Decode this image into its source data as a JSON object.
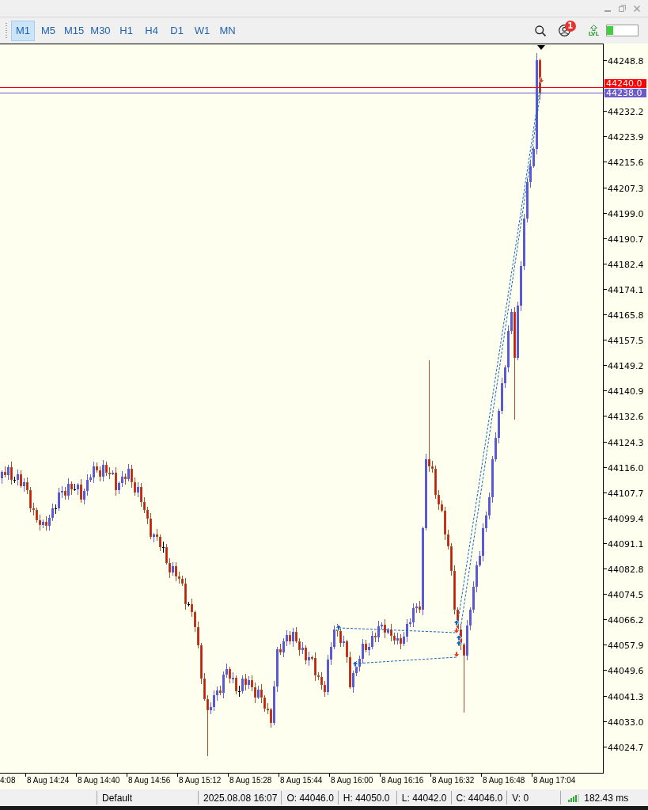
{
  "toolbar": {
    "timeframes": [
      {
        "label": "M1",
        "selected": true
      },
      {
        "label": "M5",
        "selected": false
      },
      {
        "label": "M15",
        "selected": false
      },
      {
        "label": "M30",
        "selected": false
      },
      {
        "label": "H1",
        "selected": false
      },
      {
        "label": "H4",
        "selected": false
      },
      {
        "label": "D1",
        "selected": false
      },
      {
        "label": "W1",
        "selected": false
      },
      {
        "label": "MN",
        "selected": false
      }
    ],
    "notification_badge": "1",
    "lvl_label": "LVL",
    "meter": {
      "level": 0.2
    }
  },
  "chart": {
    "price_ticks": [
      "44248.8",
      "44232.2",
      "44223.9",
      "44215.6",
      "44207.3",
      "44199.0",
      "44190.7",
      "44182.4",
      "44174.1",
      "44165.8",
      "44157.5",
      "44149.2",
      "44140.9",
      "44132.6",
      "44124.3",
      "44116.0",
      "44107.7",
      "44099.4",
      "44091.1",
      "44082.8",
      "44074.5",
      "44066.2",
      "44057.9",
      "44049.6",
      "44041.3",
      "44033.0",
      "44024.7"
    ],
    "price_lines": [
      {
        "label": "44240.0",
        "color": "#ff0000"
      },
      {
        "label": "44238.0",
        "color": "#6a5acd"
      }
    ],
    "time_labels": [
      "4:08",
      "8 Aug 14:24",
      "8 Aug 14:40",
      "8 Aug 14:56",
      "8 Aug 15:12",
      "8 Aug 15:28",
      "8 Aug 15:44",
      "8 Aug 16:00",
      "8 Aug 16:16",
      "8 Aug 16:32",
      "8 Aug 16:48",
      "8 Aug 17:04"
    ]
  },
  "status_bar": {
    "profile": "Default",
    "datetime": "2025.08.08 16:07",
    "open": "O: 44046.0",
    "high": "H: 44050.0",
    "low": "L: 44042.0",
    "close": "C: 44046.0",
    "volume": "V: 0",
    "ping": "182.43 ms"
  }
}
